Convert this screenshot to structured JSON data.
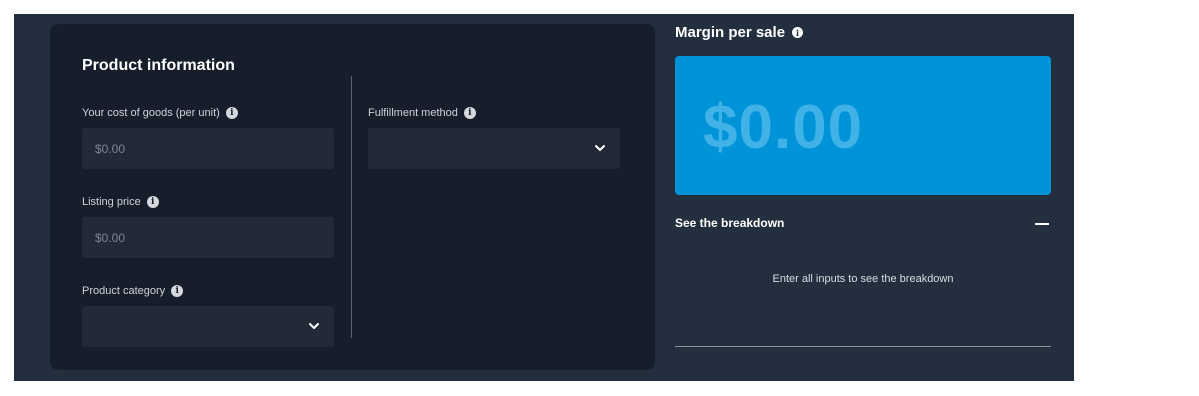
{
  "product": {
    "title": "Product information",
    "cost": {
      "label": "Your cost of goods (per unit)",
      "placeholder": "$0.00"
    },
    "listing": {
      "label": "Listing price",
      "placeholder": "$0.00"
    },
    "category": {
      "label": "Product category",
      "value": ""
    },
    "fulfillment": {
      "label": "Fulfillment method",
      "value": ""
    }
  },
  "summary": {
    "title": "Margin per sale",
    "value": "$0.00",
    "breakdown_title": "See the breakdown",
    "breakdown_message": "Enter all inputs to see the breakdown"
  },
  "icons": {
    "info": "info-icon",
    "chevron": "chevron-down-icon",
    "collapse": "minus-icon"
  },
  "colors": {
    "frame": "#232f3e",
    "panel": "#161d2b",
    "accent": "#0093d8",
    "margin_text": "#41b2e8"
  }
}
